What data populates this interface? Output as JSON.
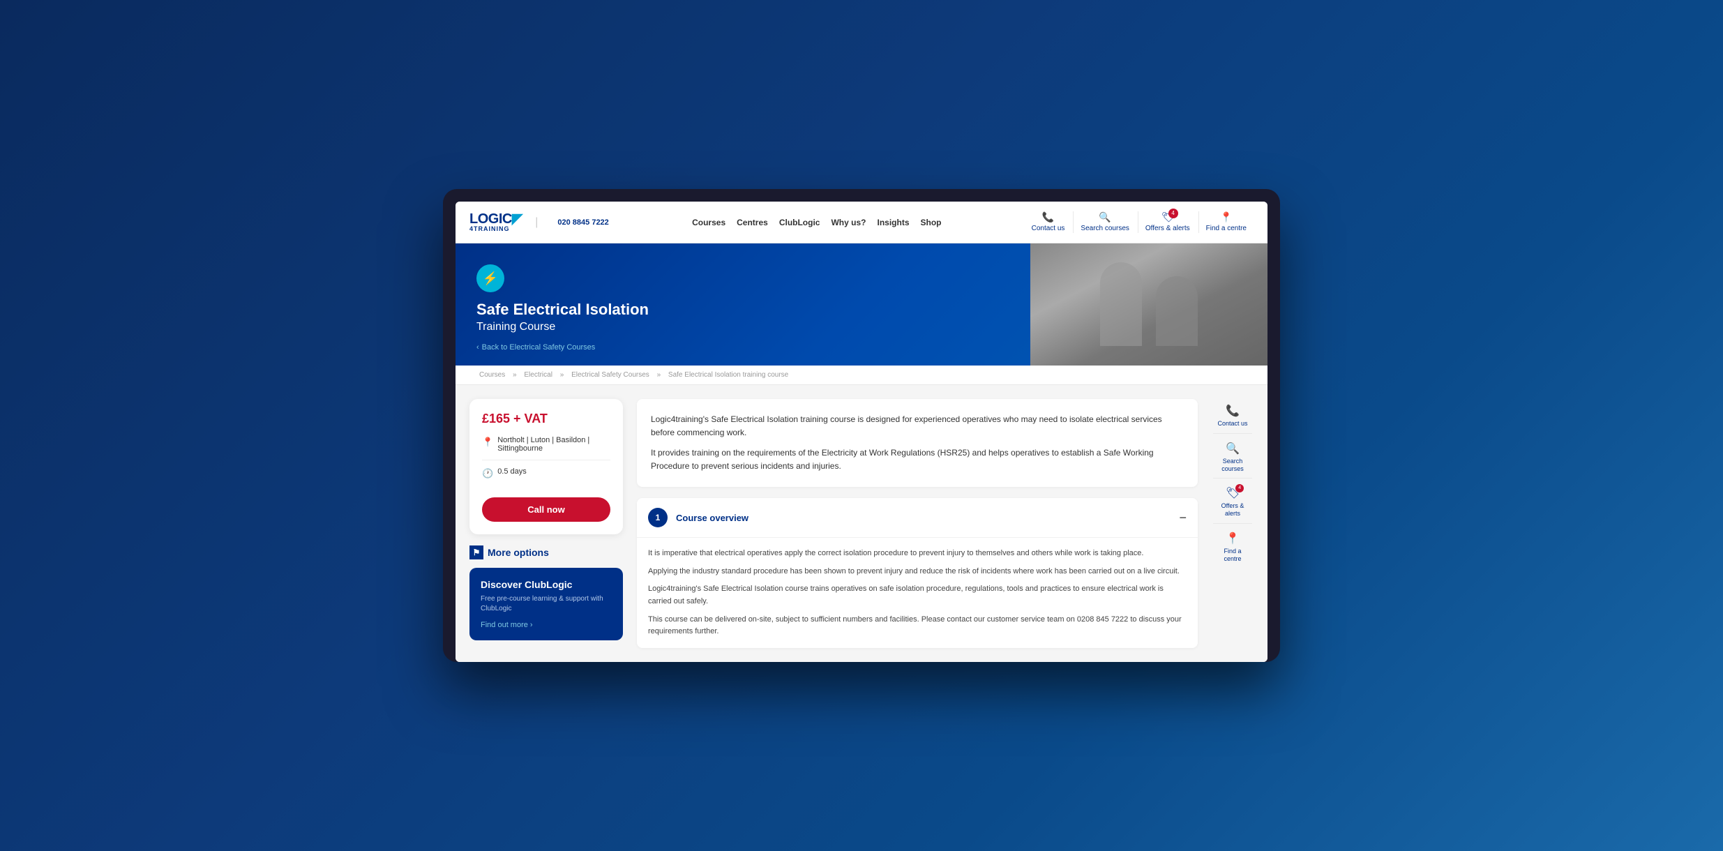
{
  "background": {
    "gradient_start": "#0a2a5e",
    "gradient_end": "#1a6aaa"
  },
  "header": {
    "logo": {
      "logic": "LOGIC",
      "number": "4",
      "training": "4TRAINING",
      "arrow": "◤"
    },
    "phone": "020 8845 7222",
    "nav": [
      {
        "label": "Courses",
        "id": "courses"
      },
      {
        "label": "Centres",
        "id": "centres"
      },
      {
        "label": "ClubLogic",
        "id": "clublogic"
      },
      {
        "label": "Why us?",
        "id": "why-us"
      },
      {
        "label": "Insights",
        "id": "insights"
      },
      {
        "label": "Shop",
        "id": "shop"
      }
    ],
    "actions": [
      {
        "label": "Contact us",
        "icon": "📞",
        "id": "contact",
        "badge": null
      },
      {
        "label": "Search courses",
        "icon": "🔍",
        "id": "search",
        "badge": null
      },
      {
        "label": "Offers & alerts",
        "icon": "🏷",
        "id": "offers",
        "badge": "4"
      },
      {
        "label": "Find a centre",
        "icon": "📍",
        "id": "find-centre",
        "badge": null
      }
    ]
  },
  "hero": {
    "icon": "⚡",
    "title": "Safe Electrical Isolation",
    "subtitle": "Training Course",
    "back_text": "Back to Electrical Safety Courses"
  },
  "breadcrumb": {
    "items": [
      "Courses",
      "Electrical",
      "Electrical Safety Courses",
      "Safe Electrical Isolation training course"
    ],
    "separator": "»"
  },
  "booking_card": {
    "price": "£165 + VAT",
    "locations": "Northolt | Luton | Basildon | Sittingbourne",
    "duration": "0.5 days",
    "call_btn": "Call now",
    "more_options_label": "More options",
    "clublogic": {
      "title": "Discover ClubLogic",
      "description": "Free pre-course learning & support with ClubLogic",
      "cta": "Find out more ›"
    }
  },
  "course_description": {
    "paragraphs": [
      "Logic4training's Safe Electrical Isolation training course is designed for experienced operatives who may need to isolate electrical services before commencing work.",
      "It provides training on the requirements of the Electricity at Work Regulations (HSR25) and helps operatives to establish a Safe Working Procedure to prevent serious incidents and injuries."
    ]
  },
  "accordion": {
    "number": "1",
    "title": "Course overview",
    "paragraphs": [
      "It is imperative that electrical operatives apply the correct isolation procedure to prevent injury to themselves and others while work is taking place.",
      "Applying the industry standard procedure has been shown to prevent injury and reduce the risk of incidents where work has been carried out on a live circuit.",
      "Logic4training's Safe Electrical Isolation course trains operatives on safe isolation procedure, regulations, tools and practices to ensure electrical work is carried out safely.",
      "This course can be delivered on-site, subject to sufficient numbers and facilities. Please contact our customer service team on 0208 845 7222 to discuss your requirements further."
    ]
  },
  "right_sidebar": {
    "actions": [
      {
        "label": "Contact us",
        "icon": "📞",
        "id": "contact-side",
        "badge": null
      },
      {
        "label": "Search courses",
        "icon": "🔍",
        "id": "search-side",
        "badge": null
      },
      {
        "label": "Offers & alerts",
        "icon": "🏷",
        "id": "offers-side",
        "badge": "4"
      },
      {
        "label": "Find a centre",
        "icon": "📍",
        "id": "find-side",
        "badge": null
      }
    ]
  }
}
